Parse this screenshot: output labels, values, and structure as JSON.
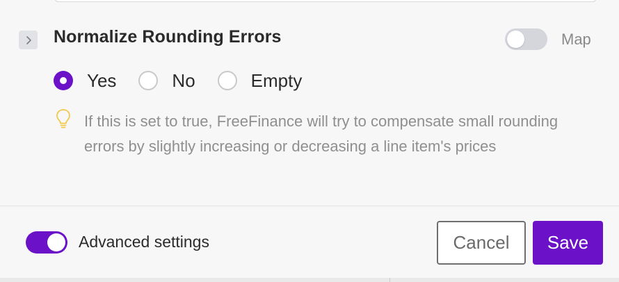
{
  "field": {
    "title": "Normalize Rounding Errors",
    "expand_icon": "chevron-right-icon",
    "map_toggle": {
      "label": "Map",
      "on": false
    },
    "options": [
      {
        "label": "Yes",
        "checked": true
      },
      {
        "label": "No",
        "checked": false
      },
      {
        "label": "Empty",
        "checked": false
      }
    ],
    "hint": {
      "icon": "lightbulb-icon",
      "text": "If this is set to true, FreeFinance will try to compensate small rounding errors by slightly increasing or decreasing a line item's prices"
    }
  },
  "footer": {
    "advanced_toggle": {
      "label": "Advanced settings",
      "on": true
    },
    "cancel_label": "Cancel",
    "save_label": "Save"
  },
  "colors": {
    "accent": "#6b12c9",
    "hint_icon": "#f2c94c",
    "toggle_off": "#d4d6db"
  }
}
